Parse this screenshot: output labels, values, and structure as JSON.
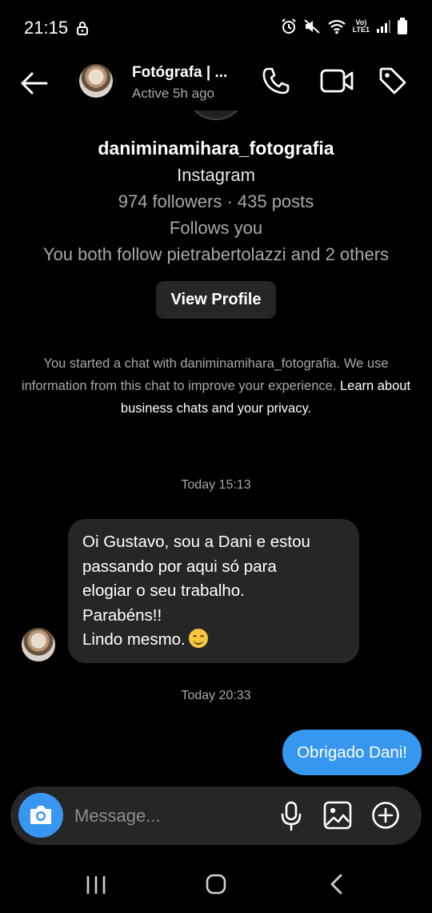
{
  "status_bar": {
    "time": "21:15",
    "network_label_top": "Vo)",
    "network_label_bottom": "LTE1",
    "icons": [
      "lock-icon",
      "alarm-icon",
      "mute-icon",
      "wifi-icon",
      "signal-icon",
      "battery-icon"
    ]
  },
  "header": {
    "name": "Fotógrafa | ...",
    "status": "Active 5h ago",
    "icons": [
      "back-arrow-icon",
      "phone-icon",
      "video-camera-icon",
      "tag-icon"
    ]
  },
  "profile": {
    "username": "daniminamihara_fotografia",
    "platform": "Instagram",
    "stats": "974 followers · 435 posts",
    "follows_you": "Follows you",
    "mutuals": "You both follow pietrabertolazzi and 2 others",
    "view_profile_label": "View Profile"
  },
  "info": {
    "text": "You started a chat with daniminamihara_fotografia. We use information from this chat to improve your experience.",
    "link": "Learn about business chats and your privacy."
  },
  "messages": {
    "timestamp_1": "Today 15:13",
    "incoming_lines": [
      "Oi Gustavo, sou a Dani e estou",
      "passando por aqui só para",
      "elogiar o seu trabalho.",
      "Parabéns!!",
      "Lindo mesmo."
    ],
    "incoming_emoji": "smiling-face-emoji",
    "timestamp_2": "Today 20:33",
    "outgoing": "Obrigado Dani!"
  },
  "composer": {
    "placeholder": "Message...",
    "icons": [
      "camera-icon",
      "microphone-icon",
      "image-icon",
      "plus-circle-icon"
    ]
  },
  "colors": {
    "background": "#000000",
    "bubble_incoming": "#262626",
    "bubble_outgoing": "#3797f0",
    "secondary_text": "#a8a8a8"
  }
}
